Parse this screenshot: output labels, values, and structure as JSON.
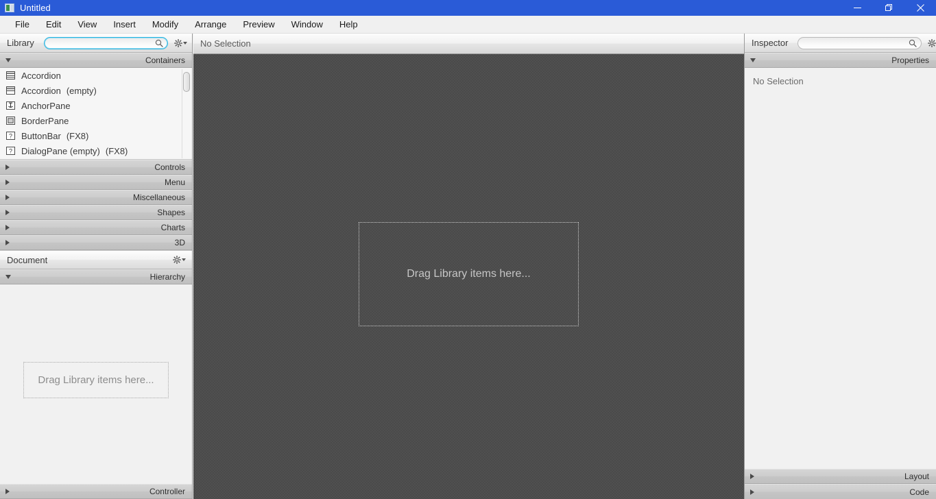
{
  "window": {
    "title": "Untitled",
    "app_icon": "scene-builder-icon",
    "controls": {
      "minimize": "minimize-icon",
      "restore": "restore-icon",
      "close": "close-icon"
    },
    "accent_color": "#2a5bd7"
  },
  "menubar": {
    "items": [
      "File",
      "Edit",
      "View",
      "Insert",
      "Modify",
      "Arrange",
      "Preview",
      "Window",
      "Help"
    ]
  },
  "library": {
    "title": "Library",
    "search_value": "",
    "search_placeholder": "",
    "search_icon": "search-icon",
    "gear_icon": "gear-icon",
    "sections": [
      {
        "label": "Containers",
        "expanded": true
      },
      {
        "label": "Controls",
        "expanded": false
      },
      {
        "label": "Menu",
        "expanded": false
      },
      {
        "label": "Miscellaneous",
        "expanded": false
      },
      {
        "label": "Shapes",
        "expanded": false
      },
      {
        "label": "Charts",
        "expanded": false
      },
      {
        "label": "3D",
        "expanded": false
      }
    ],
    "items": [
      {
        "name": "Accordion",
        "suffix": "",
        "icon": "accordion-icon"
      },
      {
        "name": "Accordion",
        "suffix": "(empty)",
        "icon": "accordion-empty-icon"
      },
      {
        "name": "AnchorPane",
        "suffix": "",
        "icon": "anchorpane-icon"
      },
      {
        "name": "BorderPane",
        "suffix": "",
        "icon": "borderpane-icon"
      },
      {
        "name": "ButtonBar",
        "suffix": "(FX8)",
        "icon": "unknown-icon"
      },
      {
        "name": "DialogPane (empty)",
        "suffix": "(FX8)",
        "icon": "unknown-icon"
      }
    ]
  },
  "document": {
    "title": "Document",
    "gear_icon": "gear-icon",
    "hierarchy": {
      "label": "Hierarchy",
      "expanded": true,
      "empty_text": "Drag Library items here..."
    },
    "controller": {
      "label": "Controller",
      "expanded": false
    }
  },
  "canvas": {
    "status": "No Selection",
    "empty_text": "Drag Library items here...",
    "background_color": "#4a4a4a"
  },
  "inspector": {
    "title": "Inspector",
    "search_value": "",
    "search_placeholder": "",
    "search_icon": "search-icon",
    "gear_icon": "gear-icon",
    "sections": [
      {
        "label": "Properties",
        "expanded": true
      },
      {
        "label": "Layout",
        "expanded": false
      },
      {
        "label": "Code",
        "expanded": false
      }
    ],
    "no_selection": "No Selection"
  }
}
